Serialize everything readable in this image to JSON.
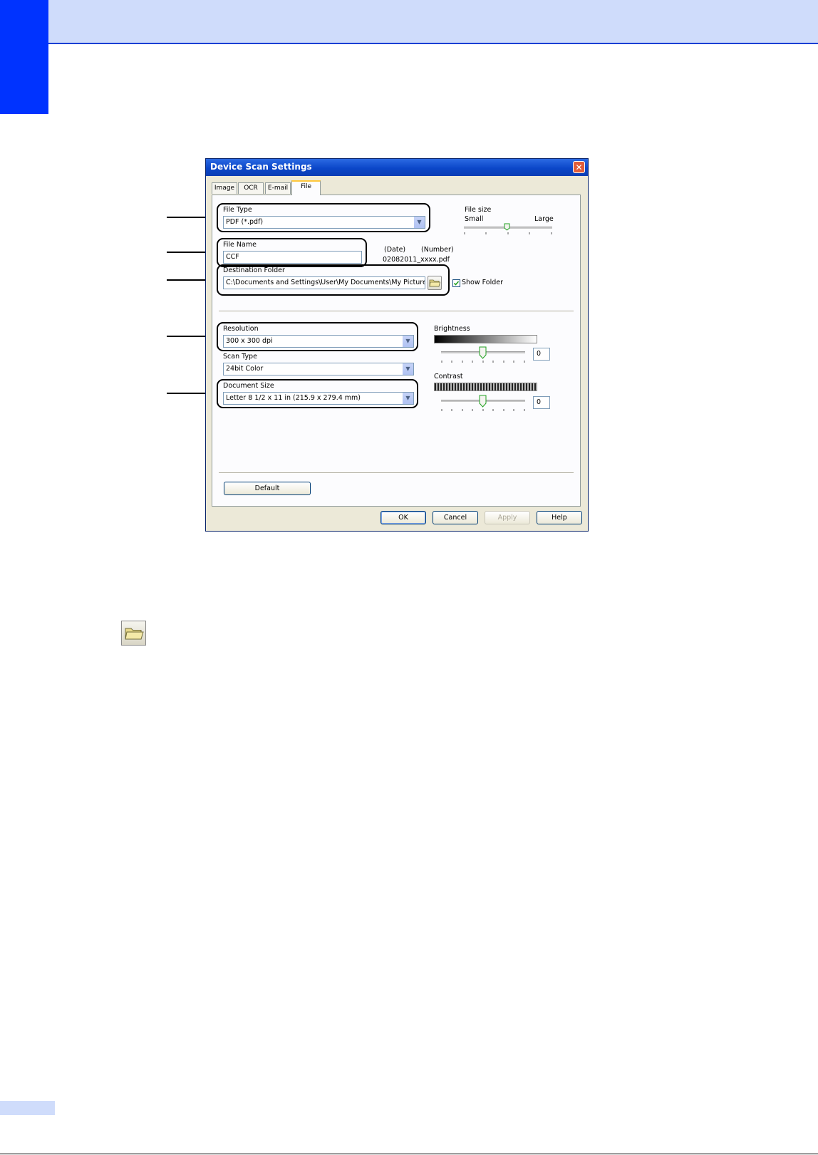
{
  "dialog": {
    "title": "Device Scan Settings",
    "close_label": "✕"
  },
  "tabs": [
    {
      "label": "Image"
    },
    {
      "label": "OCR"
    },
    {
      "label": "E-mail"
    },
    {
      "label": "File",
      "active": true
    }
  ],
  "file_type": {
    "label": "File Type",
    "value": "PDF (*.pdf)"
  },
  "file_size": {
    "label": "File size",
    "small_label": "Small",
    "large_label": "Large",
    "level_fraction": 0.5
  },
  "file_name": {
    "label": "File Name",
    "value": "CCF",
    "date_label": "(Date)",
    "number_label": "(Number)",
    "example": "02082011_xxxx.pdf"
  },
  "destination": {
    "label": "Destination Folder",
    "value": "C:\\Documents and Settings\\User\\My Documents\\My Pictures\\Cc",
    "show_folder_label": "Show Folder",
    "show_folder_checked": true
  },
  "resolution": {
    "label": "Resolution",
    "value": "300 x 300 dpi"
  },
  "scan_type": {
    "label": "Scan Type",
    "value": "24bit Color"
  },
  "document_size": {
    "label": "Document Size",
    "value": "Letter 8 1/2 x 11 in (215.9 x 279.4 mm)"
  },
  "brightness": {
    "label": "Brightness",
    "value": "0",
    "level_fraction": 0.5
  },
  "contrast": {
    "label": "Contrast",
    "value": "0",
    "level_fraction": 0.5
  },
  "buttons": {
    "default": "Default",
    "ok": "OK",
    "cancel": "Cancel",
    "apply": "Apply",
    "help": "Help"
  },
  "colors": {
    "header_band": "#cfdcfb",
    "side_tab": "#0033ff",
    "title_bar": "#0b46c8",
    "callout": "#000000"
  }
}
